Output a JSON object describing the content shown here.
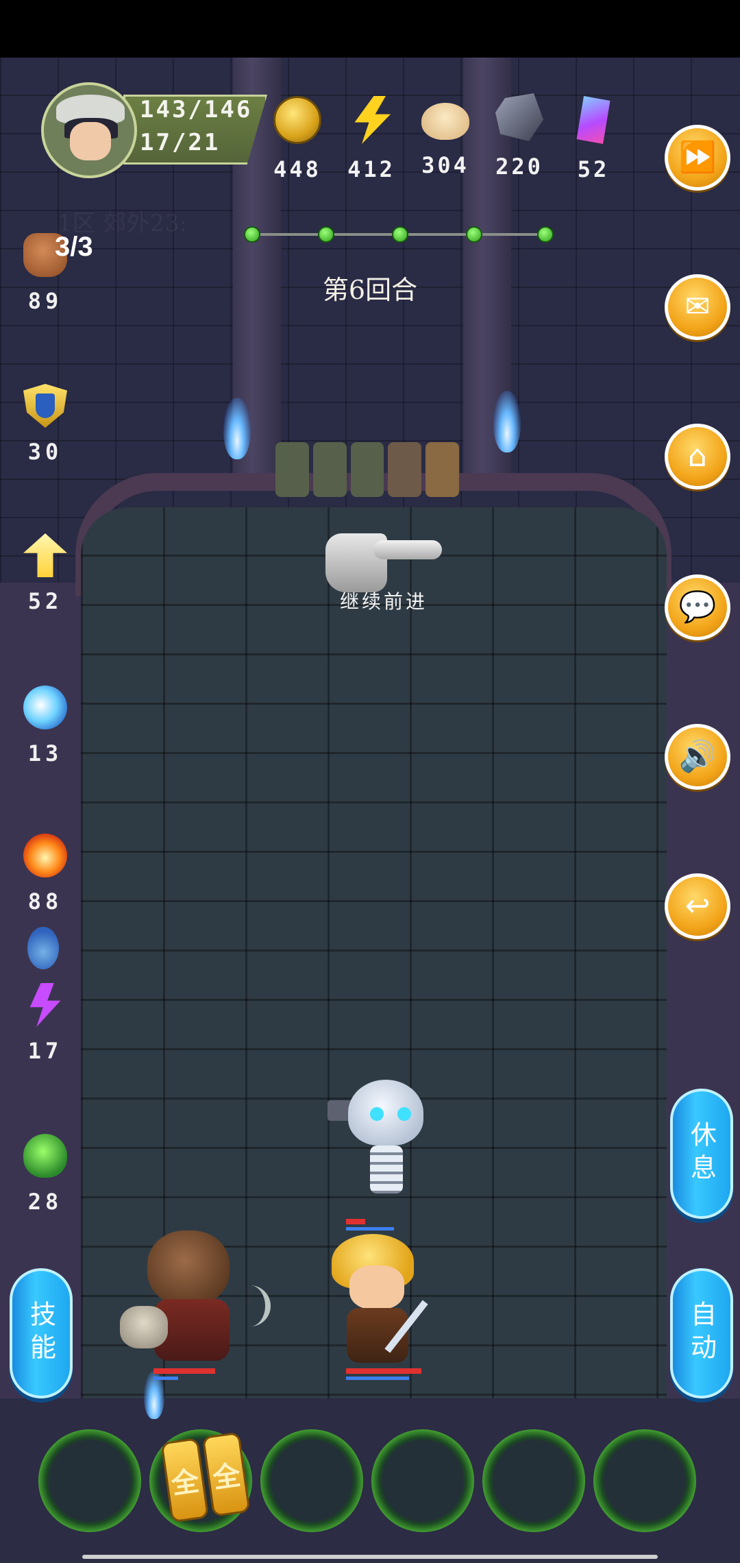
{
  "player": {
    "hp": "143/146",
    "sp": "17/21",
    "zone_label": "1区 郊外23:"
  },
  "resources": [
    {
      "icon": "gold-coin-icon",
      "value": "448"
    },
    {
      "icon": "energy-bolt-icon",
      "value": "412"
    },
    {
      "icon": "bun-food-icon",
      "value": "304"
    },
    {
      "icon": "iron-ore-icon",
      "value": "220"
    },
    {
      "icon": "gem-crystal-icon",
      "value": "52"
    }
  ],
  "progress": {
    "total_nodes": 5,
    "completed_nodes": 5
  },
  "round_label": "第6回合",
  "stats": {
    "attack_count": "3/3",
    "attack": "89",
    "defense": "30",
    "level_up": "52",
    "water": "13",
    "fire": "88",
    "lightning": "17",
    "poison": "28"
  },
  "pointer_text": "继续前进",
  "side_buttons": [
    "fast-forward-icon",
    "mail-icon",
    "home-icon",
    "chat-icon",
    "sound-icon",
    "return-icon"
  ],
  "pills": {
    "rest": "休息",
    "skill": "技能",
    "auto": "自动"
  },
  "item_slot": {
    "label": "全"
  },
  "colors": {
    "accent_orange": "#f3a51a",
    "pill_blue": "#39c8ff",
    "hp_red": "#e03131",
    "mp_blue": "#3d7ff0",
    "progress_green": "#2f9f1a"
  }
}
